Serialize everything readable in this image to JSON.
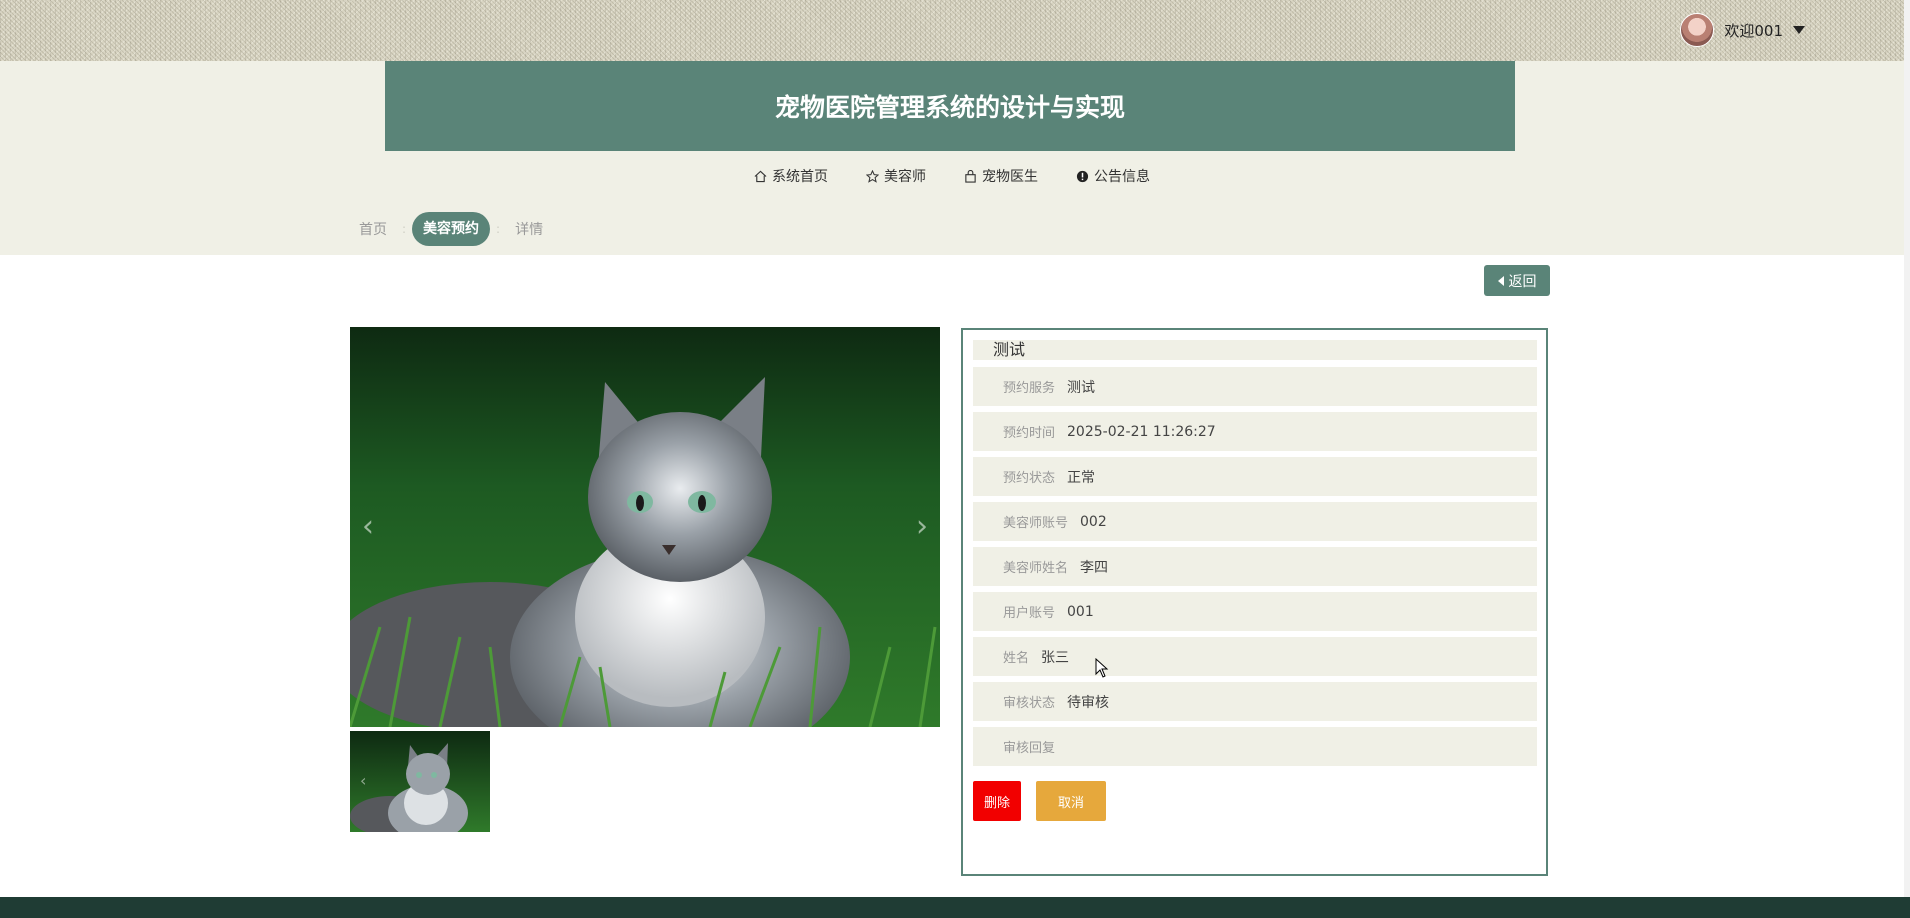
{
  "header": {
    "welcome": "欢迎001",
    "site_title": "宠物医院管理系统的设计与实现"
  },
  "nav": {
    "items": [
      {
        "label": "系统首页",
        "icon": "home-icon"
      },
      {
        "label": "美容师",
        "icon": "star-icon"
      },
      {
        "label": "宠物医生",
        "icon": "bag-icon"
      },
      {
        "label": "公告信息",
        "icon": "info-icon"
      }
    ]
  },
  "breadcrumb": {
    "home": "首页",
    "current": "美容预约",
    "detail": "详情",
    "separator": ":"
  },
  "back_label": "返回",
  "gallery": {
    "prev_glyph": "‹",
    "next_glyph": "›"
  },
  "detail": {
    "title": "测试",
    "rows": [
      {
        "label": "预约服务",
        "value": "测试"
      },
      {
        "label": "预约时间",
        "value": "2025-02-21 11:26:27"
      },
      {
        "label": "预约状态",
        "value": "正常"
      },
      {
        "label": "美容师账号",
        "value": "002"
      },
      {
        "label": "美容师姓名",
        "value": "李四"
      },
      {
        "label": "用户账号",
        "value": "001"
      },
      {
        "label": "姓名",
        "value": "张三"
      },
      {
        "label": "审核状态",
        "value": "待审核"
      },
      {
        "label": "审核回复",
        "value": ""
      }
    ],
    "delete_label": "删除",
    "cancel_label": "取消"
  },
  "colors": {
    "accent": "#5a8478",
    "band": "#f0f0e6",
    "delete": "#f20000",
    "cancel": "#e6a83c",
    "footer": "#1f3c34"
  }
}
